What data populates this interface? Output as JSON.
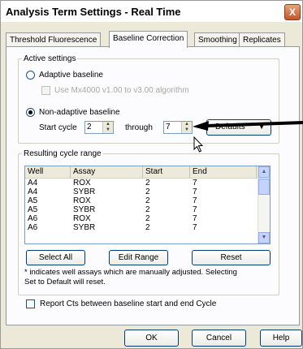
{
  "window": {
    "title": "Analysis Term Settings - Real Time",
    "close_glyph": "X"
  },
  "tabs": [
    {
      "label": "Threshold Fluorescence",
      "active": false
    },
    {
      "label": "Baseline Correction",
      "active": true
    },
    {
      "label": "Smoothing",
      "active": false
    },
    {
      "label": "Replicates",
      "active": false
    }
  ],
  "active_settings": {
    "legend": "Active settings",
    "adaptive_label": "Adaptive baseline",
    "adaptive_selected": false,
    "mx4000_label": "Use Mx4000 v1.00 to v3.00 algorithm",
    "mx4000_enabled": false,
    "nonadaptive_label": "Non-adaptive baseline",
    "nonadaptive_selected": true,
    "start_cycle_label": "Start cycle",
    "start_cycle_value": "2",
    "through_label": "through",
    "through_value": "7",
    "defaults_label": "Defaults"
  },
  "cycle_range": {
    "legend": "Resulting cycle range",
    "columns": [
      "Well",
      "Assay",
      "Start",
      "End"
    ],
    "rows": [
      [
        "A4",
        "ROX",
        "2",
        "7"
      ],
      [
        "A4",
        "SYBR",
        "2",
        "7"
      ],
      [
        "A5",
        "ROX",
        "2",
        "7"
      ],
      [
        "A5",
        "SYBR",
        "2",
        "7"
      ],
      [
        "A6",
        "ROX",
        "2",
        "7"
      ],
      [
        "A6",
        "SYBR",
        "2",
        "7"
      ]
    ],
    "select_all_label": "Select All",
    "edit_range_label": "Edit Range",
    "reset_label": "Reset",
    "note_line1": "* indicates well assays which are manually adjusted. Selecting",
    "note_line2": "Set to Default will reset."
  },
  "report_checkbox": {
    "label": "Report Cts between baseline start and end Cycle",
    "checked": false
  },
  "footer": {
    "ok_label": "OK",
    "cancel_label": "Cancel",
    "help_label": "Help"
  },
  "colors": {
    "dialog_bg": "#ece9d8",
    "panel_bg": "#fcfcfe",
    "annotation_arrow": "#000000"
  }
}
